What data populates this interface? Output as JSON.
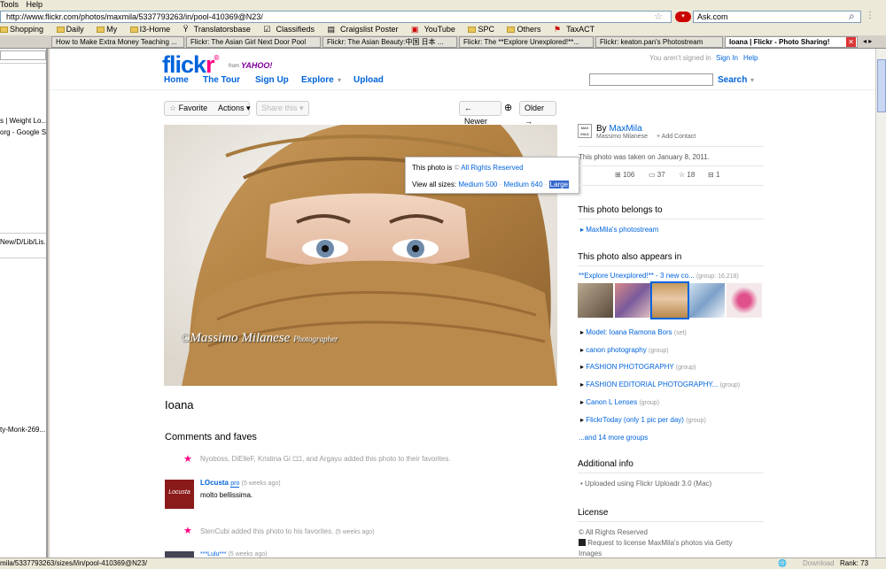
{
  "browser": {
    "menu": [
      "Tools",
      "Help"
    ],
    "url": "http://www.flickr.com/photos/maxmila/5337793263/in/pool-410369@N23/",
    "search_value": "Ask.com",
    "bookmarks": [
      "Shopping",
      "Daily",
      "My",
      "I3-Home",
      "Translatorsbase",
      "Classifieds",
      "Craigslist Poster",
      "YouTube",
      "SPC",
      "Others",
      "TaxACT"
    ],
    "tabs": [
      "How to Make Extra Money Teaching ...",
      "Flickr: The Asian Girl Next Door Pool",
      "Flickr: The Asian Beauty:中国 日本 ...",
      "Flickr: The **Explore Unexplored!**...",
      "Flickr: keaton.pan's Photostream",
      "Ioana | Flickr - Photo Sharing!"
    ],
    "status_url": "mila/5337793263/sizes/l/in/pool-410369@N23/",
    "status_right": [
      "Download",
      "Rank: 73"
    ]
  },
  "sidebar": {
    "items": [
      "s | Weight Lo...",
      "org - Google S...",
      "New/D/Lib/Lis...",
      "ty-Monk-269..."
    ]
  },
  "header": {
    "logo_flick": "flick",
    "logo_r": "r",
    "logo_from": "from",
    "logo_yahoo": "YAHOO!",
    "signed_out": "You aren't signed in",
    "sign_in": "Sign In",
    "help": "Help",
    "nav": [
      "Home",
      "The Tour",
      "Sign Up",
      "Explore",
      "Upload"
    ],
    "search_button": "Search"
  },
  "toolbar": {
    "favorite": "Favorite",
    "actions": "Actions",
    "share": "Share this",
    "newer": "← Newer",
    "older": "Older →"
  },
  "photo": {
    "title": "Ioana",
    "watermark": "©Massimo Milanese",
    "watermark_suffix": "Photographer"
  },
  "popup": {
    "license_prefix": "This photo is",
    "license": "All Rights Reserved",
    "sizes_prefix": "View all sizes:",
    "sizes": [
      "Medium 500",
      "Medium 640",
      "Large"
    ],
    "sizes_sep": "·"
  },
  "owner": {
    "by": "By",
    "name": "MaxMila",
    "realname": "Massimo Milanese",
    "add_contact": "+ Add Contact",
    "avatar_text": "MAX MILA"
  },
  "stats": {
    "taken": "This photo was taken on January 8, 2011.",
    "views": "106",
    "comments": "37",
    "faves": "18",
    "galleries": "1"
  },
  "belongs": {
    "heading": "This photo belongs to",
    "items": [
      "MaxMila's photostream"
    ]
  },
  "appears": {
    "heading": "This photo also appears in",
    "group_link": "**Explore Unexplored!** - 3 new co...",
    "group_meta": "(group: 16,218)",
    "items": [
      {
        "name": "Model: Ioana Ramona Bors",
        "meta": "(set)"
      },
      {
        "name": "canon photography",
        "meta": "(group)"
      },
      {
        "name": "FASHION PHOTOGRAPHY",
        "meta": "(group)"
      },
      {
        "name": "FASHION EDITORIAL PHOTOGRAPHY...",
        "meta": "(group)"
      },
      {
        "name": "Canon L Lenses",
        "meta": "(group)"
      },
      {
        "name": "FlickrToday (only 1 pic per day)",
        "meta": "(group)"
      }
    ],
    "more": "...and 14 more groups"
  },
  "additional": {
    "heading": "Additional info",
    "uploaded": "Uploaded using Flickr Uploadr 3.0 (Mac)"
  },
  "license_section": {
    "heading": "License",
    "rights": "All Rights Reserved",
    "getty": "Request to license MaxMila's photos via Getty",
    "getty2": "Images"
  },
  "comments": {
    "heading": "Comments and faves",
    "fav1": "Nyoboss, DiElleF, Kristina Gi 🀱, and Argayu added this photo to their favorites.",
    "c1_user": "LOcusta",
    "c1_pro": "pro",
    "c1_time": "(5 weeks ago)",
    "c1_text": "molto bellissima.",
    "c1_avatar": "Locusta",
    "fav2": "StenCubi added this photo to his favorites.",
    "fav2_time": "(5 weeks ago)",
    "c2_user": "***Lulu***",
    "c2_time": "(5 weeks ago)"
  },
  "colors": {
    "flickr_blue": "#0063dc",
    "flickr_pink": "#ff0084",
    "scarf": "#b8874a"
  }
}
